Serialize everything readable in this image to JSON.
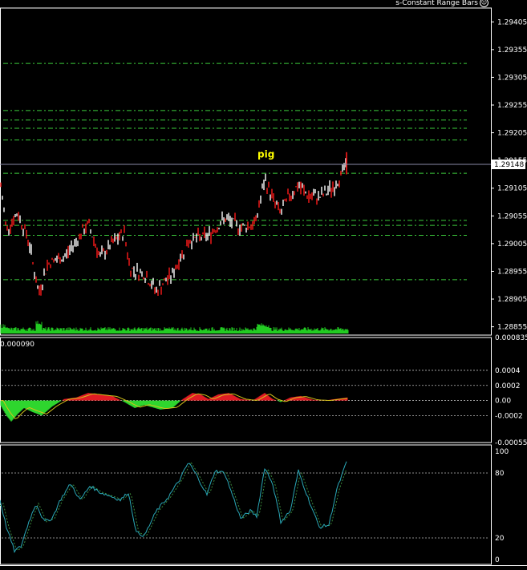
{
  "header": {
    "title": "s-Constant Range Bars",
    "icon": "smiley-icon"
  },
  "colors": {
    "background": "#000000",
    "frame": "#ffffff",
    "level": "#3ccc3c",
    "bull": "#ffffff",
    "bear": "#ff1a1a",
    "volume": "#22cc22",
    "hist_pos": "#e01c24",
    "hist_neg": "#2ed62e",
    "signal": "#d4c21a",
    "osc": "#2aa8b8",
    "label_yellow": "#ffff00"
  },
  "main_panel": {
    "price_scale_labels": [
      "1.29405",
      "1.29355",
      "1.29305",
      "1.29255",
      "1.29205",
      "1.29155",
      "1.29105",
      "1.29055",
      "1.29005",
      "1.28955",
      "1.28905",
      "1.28855"
    ],
    "current_price": "1.29148",
    "annotation": "pig",
    "levels": [
      1.2933,
      1.29245,
      1.29228,
      1.29213,
      1.29192,
      1.29132,
      1.29047,
      1.29038,
      1.2902,
      1.2894
    ],
    "y_range": [
      1.2884,
      1.2943
    ]
  },
  "macd_panel": {
    "top_left_label": "0.000090",
    "scale_labels": [
      "0.000835",
      "0.0004",
      "0.0002",
      "0.00",
      "-0.0002",
      "-0.000557"
    ],
    "dotted_levels": [
      0.0004,
      0.0002,
      0.0,
      -0.0002
    ],
    "y_range": [
      -0.000557,
      0.000835
    ]
  },
  "osc_panel": {
    "scale_labels": [
      "100",
      "80",
      "20",
      "0"
    ],
    "dotted_levels": [
      80,
      20
    ],
    "y_range": [
      0,
      100
    ]
  }
}
